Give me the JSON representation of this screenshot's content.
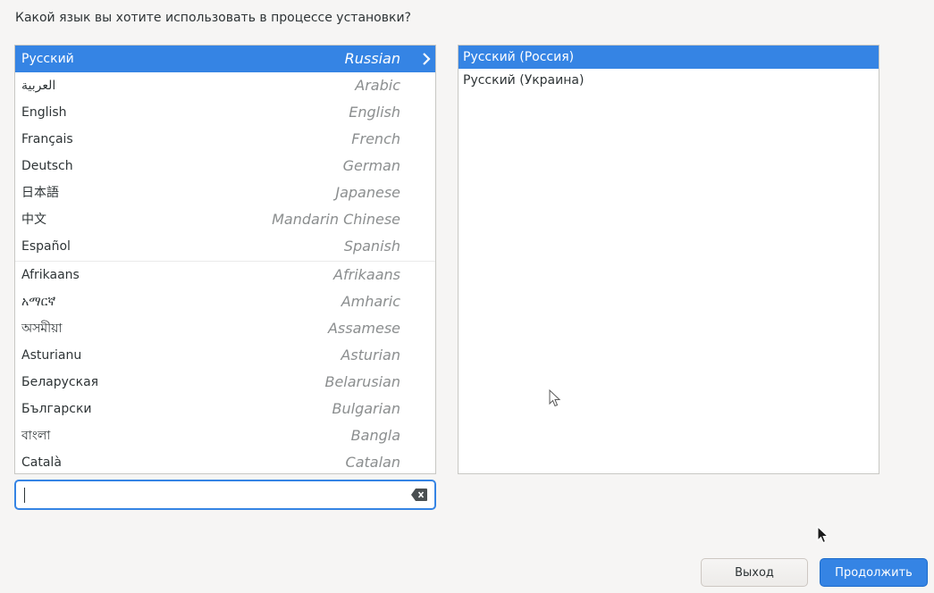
{
  "header": {
    "question": "Какой язык вы хотите использовать в процессе установки?"
  },
  "languages": [
    {
      "native": "Русский",
      "english": "Russian"
    },
    {
      "native": "العربية",
      "english": "Arabic"
    },
    {
      "native": "English",
      "english": "English"
    },
    {
      "native": "Français",
      "english": "French"
    },
    {
      "native": "Deutsch",
      "english": "German"
    },
    {
      "native": "日本語",
      "english": "Japanese"
    },
    {
      "native": "中文",
      "english": "Mandarin Chinese"
    },
    {
      "native": "Español",
      "english": "Spanish"
    },
    {
      "native": "Afrikaans",
      "english": "Afrikaans"
    },
    {
      "native": "አማርኛ",
      "english": "Amharic"
    },
    {
      "native": "অসমীয়া",
      "english": "Assamese"
    },
    {
      "native": "Asturianu",
      "english": "Asturian"
    },
    {
      "native": "Беларуская",
      "english": "Belarusian"
    },
    {
      "native": "Български",
      "english": "Bulgarian"
    },
    {
      "native": "বাংলা",
      "english": "Bangla"
    },
    {
      "native": "Català",
      "english": "Catalan"
    }
  ],
  "selected_language_index": 0,
  "locales": [
    {
      "label": "Русский (Россия)",
      "selected": true
    },
    {
      "label": "Русский (Украина)",
      "selected": false
    }
  ],
  "search": {
    "value": ""
  },
  "buttons": {
    "quit": "Выход",
    "continue": "Продолжить"
  },
  "colors": {
    "accent": "#3584e4",
    "background": "#f6f5f4"
  }
}
